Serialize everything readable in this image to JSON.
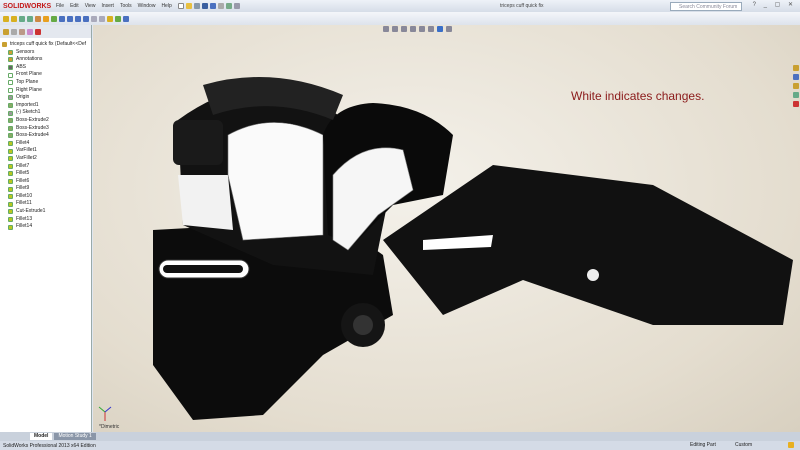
{
  "app": {
    "logo": "SOLIDWORKS",
    "title": "triceps cuff quick fix",
    "search_placeholder": "Search Community Forum",
    "window_controls": "? _ ▢ ✕"
  },
  "menu": [
    "File",
    "Edit",
    "View",
    "Insert",
    "Tools",
    "Window",
    "Help"
  ],
  "tree": {
    "root": "triceps cuff quick fix  (Default<<Def",
    "items": [
      "Sensors",
      "Annotations",
      "ABS",
      "Front Plane",
      "Top Plane",
      "Right Plane",
      "Origin",
      "Imported1",
      "(-) Sketch1",
      "Boss-Extrude2",
      "Boss-Extrude3",
      "Boss-Extrude4",
      "Fillet4",
      "VarFillet1",
      "VarFillet2",
      "Fillet7",
      "Fillet5",
      "Fillet6",
      "Fillet9",
      "Fillet10",
      "Fillet11",
      "Cut-Extrude1",
      "Fillet13",
      "Fillet14"
    ]
  },
  "viewport": {
    "annotation": "White indicates changes.",
    "view_label": "*Dimetric"
  },
  "tabs": [
    "Model",
    "Motion Study 1"
  ],
  "status": {
    "edition": "SolidWorks Professional 2013 x64 Edition",
    "mode": "Editing Part",
    "units": "Custom"
  },
  "colors": {
    "brand": "#c41a1a",
    "annotation": "#8b1a1a"
  }
}
